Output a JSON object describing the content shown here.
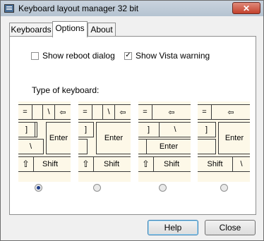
{
  "window": {
    "title": "Keyboard layout manager 32 bit",
    "close_glyph": "✕"
  },
  "tabs": [
    {
      "label": "Keyboards",
      "active": false
    },
    {
      "label": "Options",
      "active": true
    },
    {
      "label": "About",
      "active": false
    }
  ],
  "options": {
    "reboot": {
      "label": "Show reboot dialog",
      "checked": false
    },
    "vista": {
      "label": "Show Vista warning",
      "checked": true,
      "glyph": "✓"
    }
  },
  "keyboard_type": {
    "label": "Type of keyboard:",
    "layouts": [
      {
        "keys": [
          {
            "label": "="
          },
          {
            "label": ""
          },
          {
            "label": "\\"
          },
          {
            "label": "⇦"
          },
          {
            "label": "]"
          },
          {
            "label": ""
          },
          {
            "label": "\\"
          },
          {
            "label": "Enter"
          },
          {
            "label": "⇧"
          },
          {
            "label": "Shift"
          }
        ],
        "selected": true
      },
      {
        "keys": [
          {
            "label": "="
          },
          {
            "label": ""
          },
          {
            "label": "\\"
          },
          {
            "label": "⇦"
          },
          {
            "label": "]"
          },
          {
            "label": "Enter"
          },
          {
            "label": "⇧"
          },
          {
            "label": "Shift"
          }
        ],
        "selected": false
      },
      {
        "keys": [
          {
            "label": "="
          },
          {
            "label": "⇦"
          },
          {
            "label": "]"
          },
          {
            "label": "\\"
          },
          {
            "label": "Enter"
          },
          {
            "label": "⇧"
          },
          {
            "label": "Shift"
          }
        ],
        "selected": false
      },
      {
        "keys": [
          {
            "label": "="
          },
          {
            "label": "⇦"
          },
          {
            "label": "]"
          },
          {
            "label": "Enter"
          },
          {
            "label": "Shift"
          },
          {
            "label": "\\"
          }
        ],
        "selected": false
      }
    ]
  },
  "buttons": {
    "help": "Help",
    "close": "Close"
  }
}
